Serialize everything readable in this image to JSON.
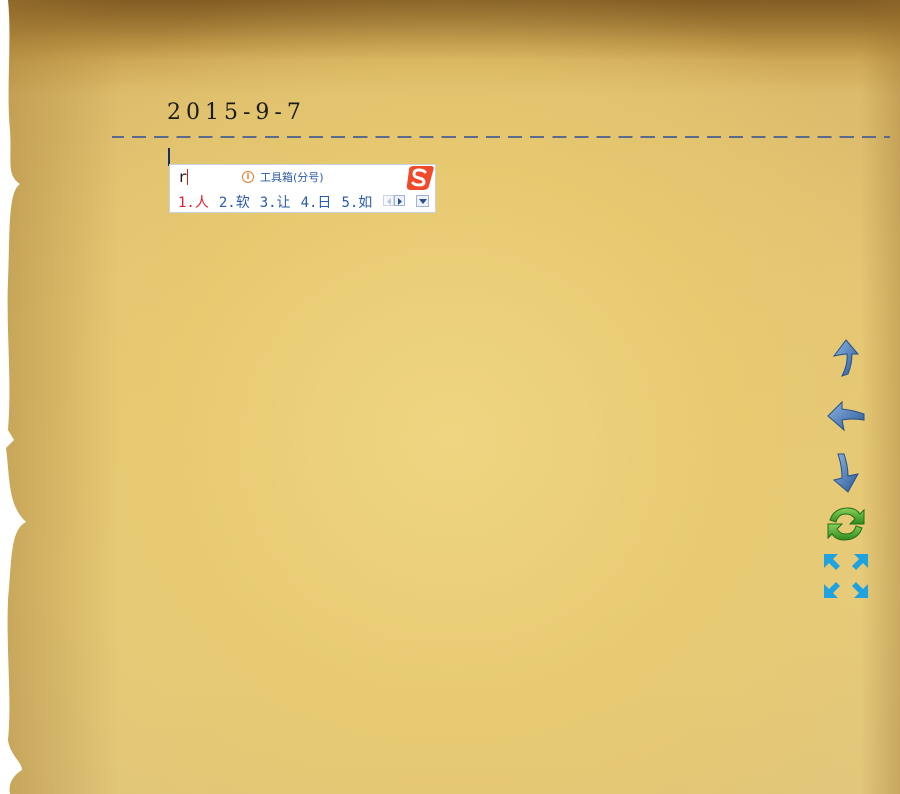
{
  "date_text": "2015-9-7",
  "ime": {
    "input_text": "r",
    "toolbox_label": "工具箱(分号)",
    "candidates": [
      "1.人",
      "2.软",
      "3.让",
      "4.日",
      "5.如"
    ],
    "brand_icon": "sogou-logo-icon"
  },
  "nav": {
    "up_icon": "arrow-up-icon",
    "back_icon": "arrow-left-icon",
    "down_icon": "arrow-down-icon",
    "refresh_icon": "refresh-icon",
    "fullscreen_icon": "fullscreen-icon"
  },
  "colors": {
    "paper": "#e6cb7c",
    "candidate_active": "#e02030",
    "candidate": "#2a5aa8",
    "nav_arrow": "#3a6fb0",
    "refresh": "#4caa2c",
    "fullscreen": "#1fa3e0"
  }
}
